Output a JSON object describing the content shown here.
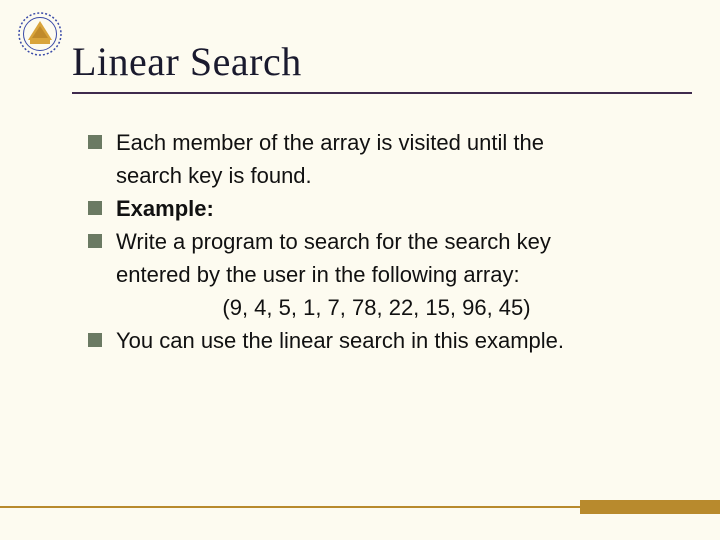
{
  "title": "Linear Search",
  "bullets": {
    "b1_line1": "Each member of the array is visited until the",
    "b1_line2": "search key is found.",
    "b2": "Example:",
    "b3_line1": " Write a program to search for the search key",
    "b3_line2": "entered by the user in the following array:",
    "b3_data": "(9, 4, 5, 1, 7, 78, 22, 15, 96, 45)",
    "b4": "You can use the linear search in this example."
  }
}
